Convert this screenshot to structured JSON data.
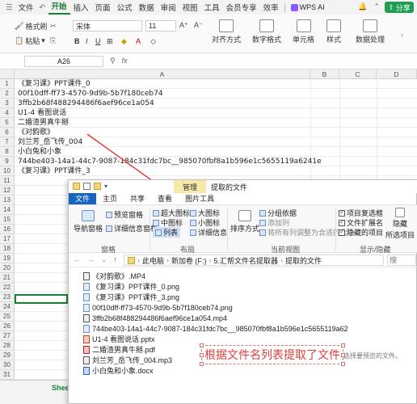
{
  "menubar": {
    "items": [
      "文件",
      "插入",
      "页面",
      "公式",
      "数据",
      "审阅",
      "视图",
      "工具",
      "会员专享",
      "效率"
    ],
    "active": "开始",
    "wps_ai": "WPS AI",
    "share": "分享"
  },
  "ribbon": {
    "format_painter": "格式刷",
    "paste": "粘贴",
    "font_name": "宋体",
    "font_size": "11",
    "align": "对齐方式",
    "number_format": "数字格式",
    "cell": "单元格",
    "style": "样式",
    "data_process": "数据处理"
  },
  "formula_bar": {
    "name_box": "A26",
    "fx": "fx"
  },
  "columns": [
    "A",
    "B",
    "C",
    "D"
  ],
  "rows": [
    "1",
    "2",
    "3",
    "4",
    "5",
    "6",
    "7",
    "8",
    "9",
    "10",
    "11",
    "12",
    "13",
    "14",
    "15",
    "16",
    "17",
    "18",
    "19",
    "20",
    "21",
    "22",
    "23",
    "24",
    "25",
    "26",
    "27",
    "28",
    "29",
    "30",
    "31"
  ],
  "cells": [
    "《复习课》PPT课件_0",
    "00f10dff-ff73-4570-9d9b-5b7f180ceb74",
    "3ffb2b68f488294486f6aef96ce1a054",
    "U1-4 看图说话",
    "二婚渣男真牛掰",
    "《对韵歌》",
    "刘兰芳_岳飞传_004",
    "小白兔和小象",
    "744be403-14a1-44c7-9087-184c31fdc7bc__985070fbf8a1b596e1c5655119a6241e",
    "《复习课》PPT课件_3"
  ],
  "sheet_tab": "Shee",
  "explorer": {
    "manage": "管理",
    "title": "提取的文件",
    "tabs": [
      "文件",
      "主页",
      "共享",
      "查看",
      "图片工具"
    ],
    "nav_pane": "导航窗格",
    "preview_pane": "预览窗格",
    "details_pane": "详细信息窗格",
    "layout_items": [
      "超大图标",
      "大图标",
      "中图标",
      "小图标",
      "列表",
      "详细信息"
    ],
    "sort": "排序方式",
    "group_by": "分组依据",
    "add_column": "添加列",
    "fit_columns": "将所有列调整为合适的大小",
    "item_checkbox": "项目复选框",
    "file_ext": "文件扩展名",
    "hidden_items": "隐藏的项目",
    "hide_selected": "隐藏",
    "selected_items": "所选项目",
    "groups": [
      "窗格",
      "布局",
      "当前视图",
      "显示/隐藏"
    ],
    "breadcrumb": [
      "此电脑",
      "新加卷 (F:)",
      "5.汇帮文件名提取器",
      "提取的文件"
    ],
    "search": "搜",
    "files": [
      {
        "name": "《对韵歌》.MP4",
        "kind": "vid"
      },
      {
        "name": "《复习课》PPT课件_0.png",
        "kind": "img"
      },
      {
        "name": "《复习课》PPT课件_3.png",
        "kind": "img"
      },
      {
        "name": "00f10dff-ff73-4570-9d9b-5b7f180ceb74.png",
        "kind": "img"
      },
      {
        "name": "3ffb2b68f488294486f6aef96ce1a054.mp4",
        "kind": "vid"
      },
      {
        "name": "744be403-14a1-44c7-9087-184c31fdc7bc__985070fbf8a1b596e1c5655119a62",
        "kind": "img"
      },
      {
        "name": "U1-4 看图说话.pptx",
        "kind": "ppt"
      },
      {
        "name": "二婚渣男真牛掰.pdf",
        "kind": "pdf"
      },
      {
        "name": "刘兰芳_岳飞传_004.mp3",
        "kind": "mp3"
      },
      {
        "name": "小白兔和小象.docx",
        "kind": "doc"
      }
    ],
    "preview_hint": "选择要预览的文件。"
  },
  "annotation": "根据文件名列表提取了文件",
  "colors": {
    "accent": "#1a7f37",
    "explorer_file_tab": "#1565c0",
    "annotation": "#e23c3c"
  }
}
